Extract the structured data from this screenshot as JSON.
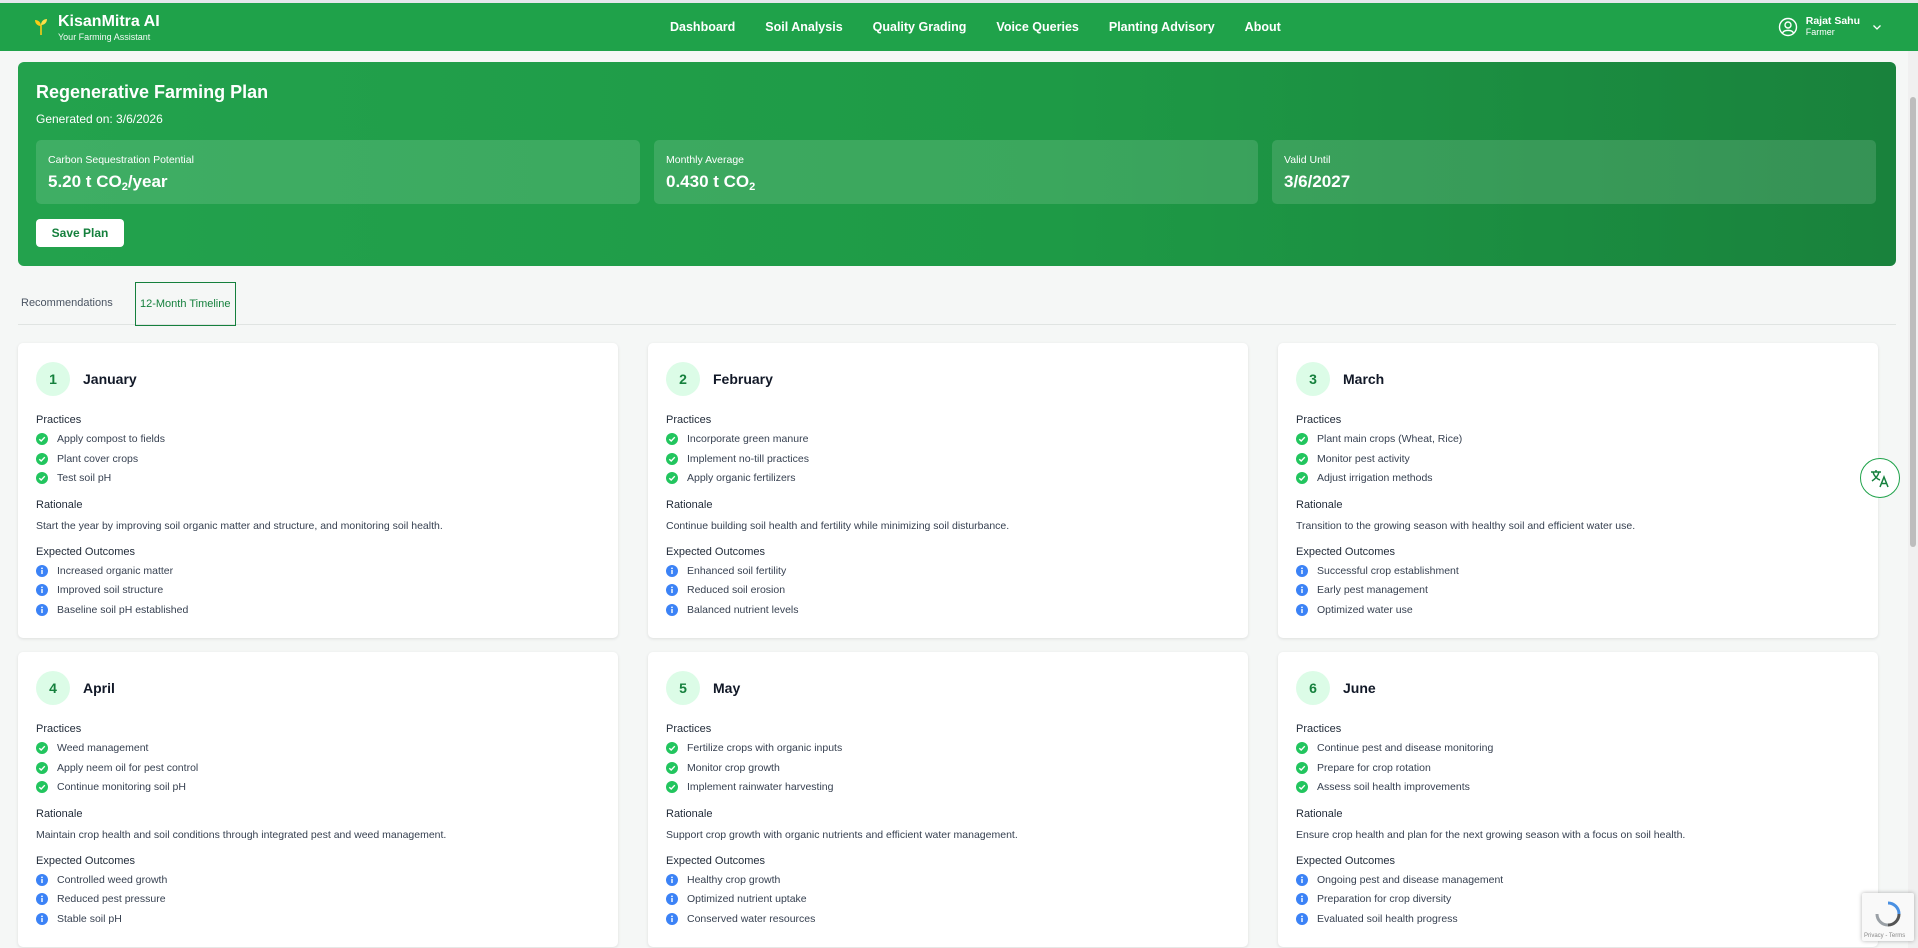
{
  "nav": {
    "brand_title": "KisanMitra AI",
    "brand_subtitle": "Your Farming Assistant",
    "links": [
      "Dashboard",
      "Soil Analysis",
      "Quality Grading",
      "Voice Queries",
      "Planting Advisory",
      "About"
    ],
    "user_name": "Rajat Sahu",
    "user_role": "Farmer"
  },
  "plan": {
    "title": "Regenerative Farming Plan",
    "generated": "Generated on: 3/6/2026",
    "stats": [
      {
        "label": "Carbon Sequestration Potential",
        "value_pre": "5.20 t CO",
        "value_sub": "2",
        "value_post": "/year"
      },
      {
        "label": "Monthly Average",
        "value_pre": "0.430 t CO",
        "value_sub": "2",
        "value_post": ""
      },
      {
        "label": "Valid Until",
        "value_pre": "3/6/2027",
        "value_sub": "",
        "value_post": ""
      }
    ],
    "save_label": "Save Plan"
  },
  "tabs": {
    "recommendations": "Recommendations",
    "timeline": "12-Month Timeline"
  },
  "section_labels": {
    "practices": "Practices",
    "rationale": "Rationale",
    "outcomes": "Expected Outcomes"
  },
  "months": [
    {
      "num": "1",
      "name": "January",
      "practices": [
        "Apply compost to fields",
        "Plant cover crops",
        "Test soil pH"
      ],
      "rationale": "Start the year by improving soil organic matter and structure, and monitoring soil health.",
      "outcomes": [
        "Increased organic matter",
        "Improved soil structure",
        "Baseline soil pH established"
      ]
    },
    {
      "num": "2",
      "name": "February",
      "practices": [
        "Incorporate green manure",
        "Implement no-till practices",
        "Apply organic fertilizers"
      ],
      "rationale": "Continue building soil health and fertility while minimizing soil disturbance.",
      "outcomes": [
        "Enhanced soil fertility",
        "Reduced soil erosion",
        "Balanced nutrient levels"
      ]
    },
    {
      "num": "3",
      "name": "March",
      "practices": [
        "Plant main crops (Wheat, Rice)",
        "Monitor pest activity",
        "Adjust irrigation methods"
      ],
      "rationale": "Transition to the growing season with healthy soil and efficient water use.",
      "outcomes": [
        "Successful crop establishment",
        "Early pest management",
        "Optimized water use"
      ]
    },
    {
      "num": "4",
      "name": "April",
      "practices": [
        "Weed management",
        "Apply neem oil for pest control",
        "Continue monitoring soil pH"
      ],
      "rationale": "Maintain crop health and soil conditions through integrated pest and weed management.",
      "outcomes": [
        "Controlled weed growth",
        "Reduced pest pressure",
        "Stable soil pH"
      ]
    },
    {
      "num": "5",
      "name": "May",
      "practices": [
        "Fertilize crops with organic inputs",
        "Monitor crop growth",
        "Implement rainwater harvesting"
      ],
      "rationale": "Support crop growth with organic nutrients and efficient water management.",
      "outcomes": [
        "Healthy crop growth",
        "Optimized nutrient uptake",
        "Conserved water resources"
      ]
    },
    {
      "num": "6",
      "name": "June",
      "practices": [
        "Continue pest and disease monitoring",
        "Prepare for crop rotation",
        "Assess soil health improvements"
      ],
      "rationale": "Ensure crop health and plan for the next growing season with a focus on soil health.",
      "outcomes": [
        "Ongoing pest and disease management",
        "Preparation for crop diversity",
        "Evaluated soil health progress"
      ]
    }
  ],
  "recaptcha": {
    "text": "Privacy - Terms"
  },
  "colors": {
    "primary": "#1fa24a",
    "dark": "#15803d",
    "check": "#22c55e",
    "info": "#3b82f6"
  },
  "icons": {
    "brand": "sprout-icon",
    "user": "user-circle-icon",
    "check": "check-circle-icon",
    "info": "info-circle-icon",
    "translate": "translate-icon"
  }
}
